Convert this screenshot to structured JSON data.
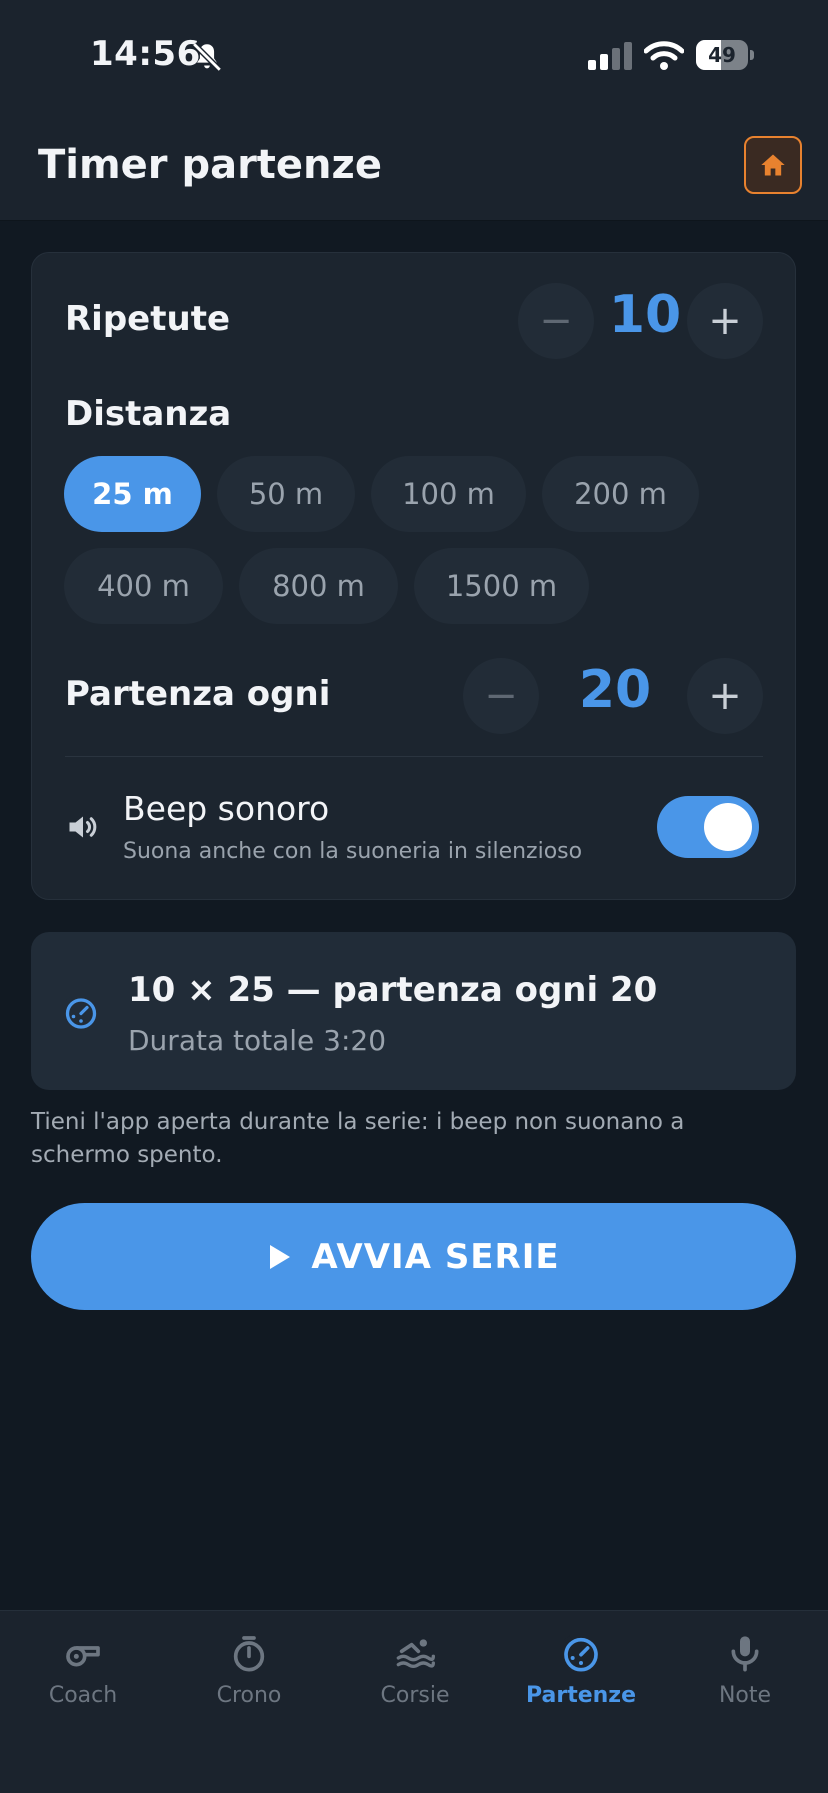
{
  "status_bar": {
    "time": "14:56",
    "battery": "49",
    "battery_level": 0.49
  },
  "header": {
    "title": "Timer partenze",
    "home_icon": "home-icon"
  },
  "settings": {
    "reps": {
      "label": "Ripetute",
      "value": "10",
      "minus": "−",
      "plus": "+"
    },
    "distance": {
      "label": "Distanza",
      "options": [
        "25 m",
        "50 m",
        "100 m",
        "200 m",
        "400 m",
        "800 m",
        "1500 m"
      ],
      "selected": "25 m"
    },
    "interval": {
      "label": "Partenza ogni",
      "value": "20",
      "minus": "−",
      "plus": "+"
    },
    "beep": {
      "title": "Beep sonoro",
      "subtitle": "Suona anche con la suoneria in silenzioso",
      "enabled": true
    }
  },
  "summary": {
    "title": "10 × 25 — partenza ogni 20",
    "subtitle": "Durata totale 3:20"
  },
  "note": "Tieni l'app aperta durante la serie: i beep non suonano a schermo spento.",
  "start_button": {
    "label": "AVVIA SERIE"
  },
  "tabs": [
    {
      "label": "Coach",
      "icon": "whistle-icon"
    },
    {
      "label": "Crono",
      "icon": "stopwatch-icon"
    },
    {
      "label": "Corsie",
      "icon": "swimmer-icon"
    },
    {
      "label": "Partenze",
      "icon": "timer-icon",
      "active": true
    },
    {
      "label": "Note",
      "icon": "microphone-icon"
    }
  ],
  "colors": {
    "accent": "#4a96e8",
    "home_accent": "#e8822f",
    "background": "#111922"
  }
}
